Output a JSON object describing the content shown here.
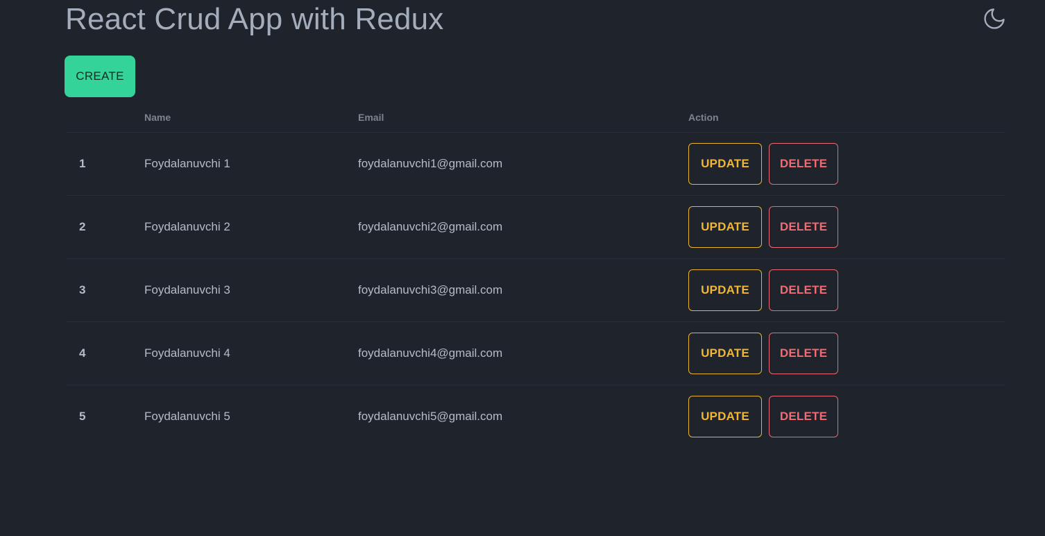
{
  "header": {
    "title": "React Crud App with Redux",
    "theme_icon": "moon-icon"
  },
  "toolbar": {
    "create_label": "CREATE"
  },
  "table": {
    "columns": {
      "id": "",
      "name": "Name",
      "email": "Email",
      "action": "Action"
    },
    "rows": [
      {
        "id": "1",
        "name": "Foydalanuvchi 1",
        "email": "foydalanuvchi1@gmail.com",
        "update_label": "UPDATE",
        "delete_label": "DELETE"
      },
      {
        "id": "2",
        "name": "Foydalanuvchi 2",
        "email": "foydalanuvchi2@gmail.com",
        "update_label": "UPDATE",
        "delete_label": "DELETE"
      },
      {
        "id": "3",
        "name": "Foydalanuvchi 3",
        "email": "foydalanuvchi3@gmail.com",
        "update_label": "UPDATE",
        "delete_label": "DELETE"
      },
      {
        "id": "4",
        "name": "Foydalanuvchi 4",
        "email": "foydalanuvchi4@gmail.com",
        "update_label": "UPDATE",
        "delete_label": "DELETE"
      },
      {
        "id": "5",
        "name": "Foydalanuvchi 5",
        "email": "foydalanuvchi5@gmail.com",
        "update_label": "UPDATE",
        "delete_label": "DELETE"
      }
    ]
  },
  "colors": {
    "background": "#1f232b",
    "create_button": "#34d399",
    "update_accent": "#f2b632",
    "delete_accent": "#f26b74"
  }
}
